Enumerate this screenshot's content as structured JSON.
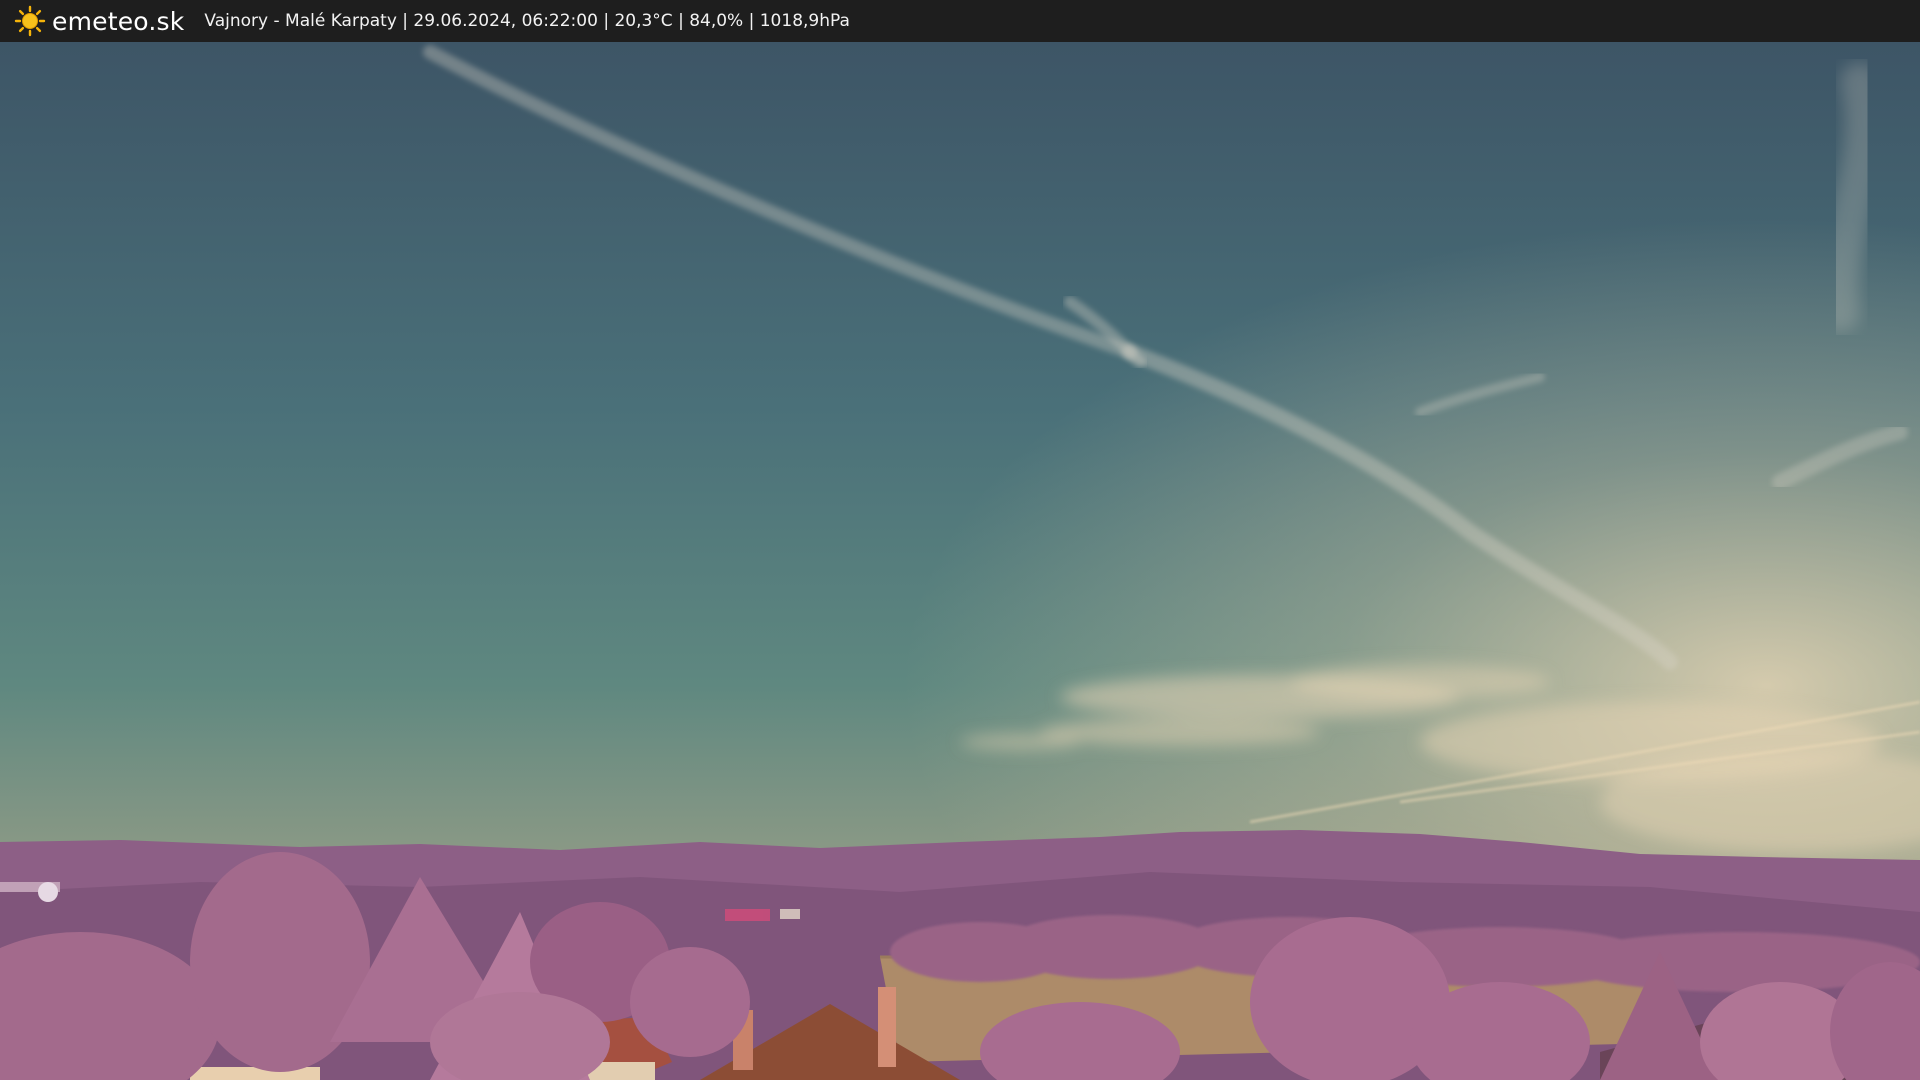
{
  "brand": {
    "name": "emeteo.sk",
    "icon": "sun-icon",
    "icon_color": "#f4b400"
  },
  "caption": "Vajnory - Malé Karpaty | 29.06.2024, 06:22:00 | 20,3°C | 84,0% | 1018,9hPa",
  "colors": {
    "sky_top": "#3e5666",
    "sky_mid": "#4f7b80",
    "sky_horizon": "#8f9a86",
    "clouds": "#e6d2b2",
    "hills": "#8e5f86",
    "foliage": "#a86b8e",
    "roof": "#9a5c40",
    "field": "#b08c68"
  }
}
